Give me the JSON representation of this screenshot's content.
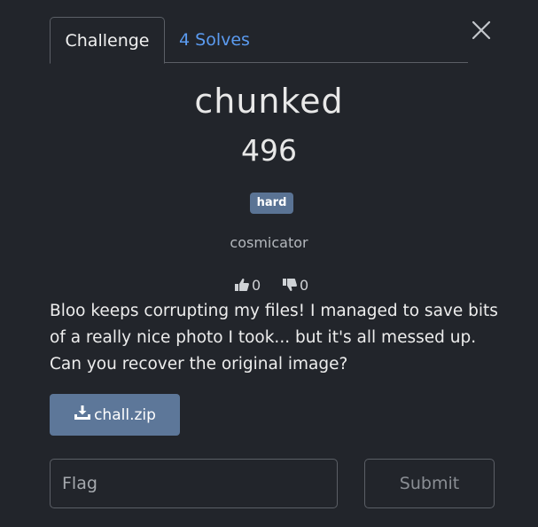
{
  "tabs": {
    "challenge_label": "Challenge",
    "solves_label": "4 Solves"
  },
  "challenge": {
    "name": "chunked",
    "points": "496",
    "difficulty": "hard",
    "author": "cosmicator",
    "upvotes": "0",
    "downvotes": "0",
    "description": "Bloo keeps corrupting my files! I managed to save bits of a really nice photo I took... but it's all messed up. Can you recover the original image?"
  },
  "attachment": {
    "filename": "chall.zip",
    "icon": "download-icon"
  },
  "flag_form": {
    "placeholder": "Flag",
    "value": "",
    "submit_label": "Submit"
  },
  "icons": {
    "close": "close-icon",
    "upvote": "thumbs-up-icon",
    "downvote": "thumbs-down-icon"
  },
  "colors": {
    "background": "#22252b",
    "accent_link": "#5b9bf0",
    "badge": "#5a7394",
    "button": "#5d7799",
    "border": "#5b5f66"
  }
}
